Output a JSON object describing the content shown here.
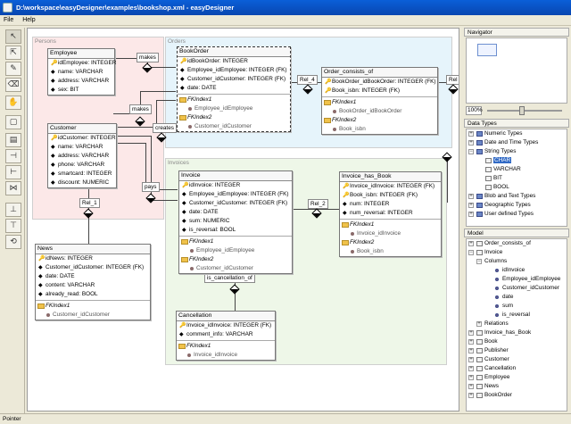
{
  "window": {
    "title": "D:\\workspace\\easyDesigner\\examples\\bookshop.xml - easyDesigner"
  },
  "menu": [
    {
      "label": "File"
    },
    {
      "label": "Help"
    }
  ],
  "areas": {
    "persons": "Persons",
    "orders": "Orders",
    "invoices": "Invoices"
  },
  "tables": {
    "employee": {
      "name": "Employee",
      "cols": [
        "idEmployee: INTEGER",
        "name: VARCHAR",
        "address: VARCHAR",
        "sex: BIT"
      ]
    },
    "customer": {
      "name": "Customer",
      "cols": [
        "idCustomer: INTEGER",
        "name: VARCHAR",
        "address: VARCHAR",
        "phone: VARCHAR",
        "smartcard: INTEGER",
        "discount: NUMERIC"
      ]
    },
    "news": {
      "name": "News",
      "cols": [
        "idNews: INTEGER",
        "Customer_idCustomer: INTEGER (FK)",
        "date: DATE",
        "content: VARCHAR",
        "already_read: BOOL"
      ],
      "fks": [
        {
          "name": "FKIndex1",
          "col": "Customer_idCustomer"
        }
      ]
    },
    "bookorder": {
      "name": "BookOrder",
      "cols": [
        "idBookOrder: INTEGER",
        "Employee_idEmployee: INTEGER (FK)",
        "Customer_idCustomer: INTEGER (FK)",
        "date: DATE"
      ],
      "fks": [
        {
          "name": "FKIndex1",
          "col": "Employee_idEmployee"
        },
        {
          "name": "FKIndex2",
          "col": "Customer_idCustomer"
        }
      ]
    },
    "order_consists_of": {
      "name": "Order_consists_of",
      "cols": [
        "BookOrder_idBookOrder: INTEGER (FK)",
        "Book_isbn: INTEGER (FK)"
      ],
      "fks": [
        {
          "name": "FKIndex1",
          "col": "BookOrder_idBookOrder"
        },
        {
          "name": "FKIndex2",
          "col": "Book_isbn"
        }
      ]
    },
    "invoice": {
      "name": "Invoice",
      "cols": [
        "idInvoice: INTEGER",
        "Employee_idEmployee: INTEGER (FK)",
        "Customer_idCustomer: INTEGER (FK)",
        "date: DATE",
        "sum: NUMERIC",
        "is_reversal: BOOL"
      ],
      "fks": [
        {
          "name": "FKIndex1",
          "col": "Employee_idEmployee"
        },
        {
          "name": "FKIndex2",
          "col": "Customer_idCustomer"
        }
      ]
    },
    "invoice_has_book": {
      "name": "Invoice_has_Book",
      "cols": [
        "Invoice_idInvoice: INTEGER (FK)",
        "Book_isbn: INTEGER (FK)",
        "num: INTEGER",
        "num_reversal: INTEGER"
      ],
      "fks": [
        {
          "name": "FKIndex1",
          "col": "Invoice_idInvoice"
        },
        {
          "name": "FKIndex2",
          "col": "Book_isbn"
        }
      ]
    },
    "cancellation": {
      "name": "Cancellation",
      "cols": [
        "Invoice_idInvoice: INTEGER (FK)",
        "comment_info: VARCHAR"
      ],
      "fks": [
        {
          "name": "FKIndex1",
          "col": "Invoice_idInvoice"
        }
      ]
    }
  },
  "relations": {
    "makes1": "makes",
    "makes2": "makes",
    "creates": "creates",
    "pays": "pays",
    "rel1": "Rel_1",
    "rel2": "Rel_2",
    "rel4": "Rel_4",
    "rel3": "Rel",
    "is_canc": "is_cancellation_of"
  },
  "navigator": {
    "title": "Navigator",
    "zoom": "100%"
  },
  "datatypes": {
    "title": "Data Types",
    "items": [
      "Numeric Types",
      "Date and Time Types",
      "String Types",
      "CHAR",
      "VARCHAR",
      "BIT",
      "BOOL",
      "Blob and Text Types",
      "Geographic Types",
      "User defined Types"
    ]
  },
  "model": {
    "title": "Model",
    "items": [
      "Order_consists_of",
      "Invoice",
      "Columns",
      "idInvoice",
      "Employee_idEmployee",
      "Customer_idCustomer",
      "date",
      "sum",
      "is_reversal",
      "Relations",
      "Invoice_has_Book",
      "Book",
      "Publisher",
      "Customer",
      "Cancellation",
      "Employee",
      "News",
      "BookOrder"
    ]
  },
  "status": "Pointer"
}
